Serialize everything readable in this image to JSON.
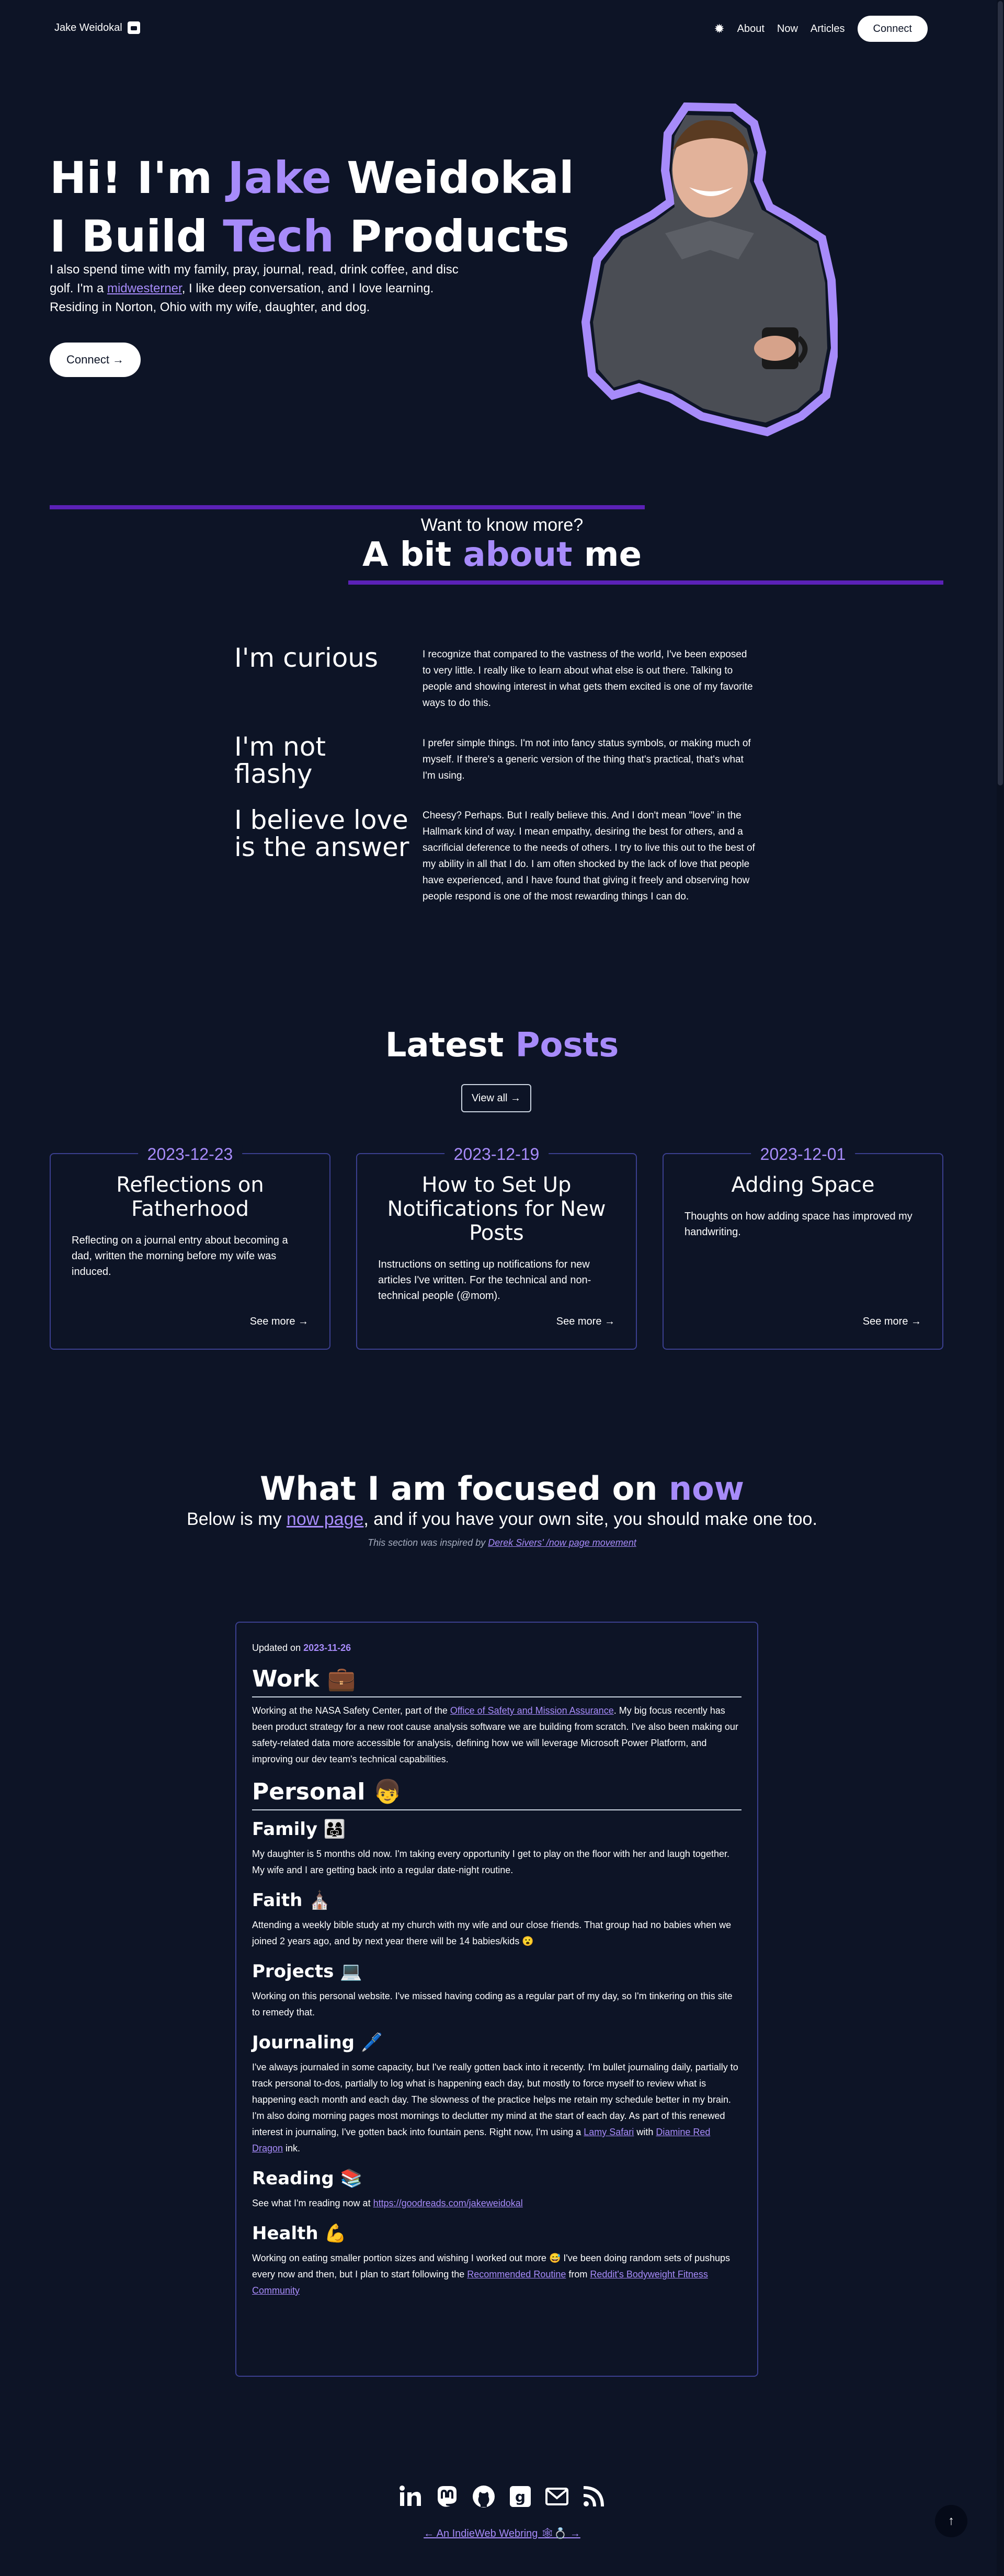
{
  "nav": {
    "brand": "Jake Weidokal",
    "links": [
      "About",
      "Now",
      "Articles"
    ],
    "connect": "Connect"
  },
  "hero": {
    "line1_pre": "Hi! I'm ",
    "line1_accent": "Jake",
    "line1_post": " Weidokal",
    "line2_pre": "I Build ",
    "line2_accent": "Tech",
    "line2_post": " Products",
    "text_pre": "I also spend time with my family, pray, journal, read, drink coffee, and disc golf. I'm a ",
    "text_link": "midwesterner",
    "text_post": ", I like deep conversation, and I love learning. Residing in Norton, Ohio with my wife, daughter, and dog.",
    "button": "Connect →"
  },
  "about": {
    "kicker": "Want to know more?",
    "title_pre": "A bit ",
    "title_accent": "about",
    "title_post": " me",
    "traits": [
      {
        "title": "I'm curious",
        "text": "I recognize that compared to the vastness of the world, I've been exposed to very little. I really like to learn about what else is out there. Talking to people and showing interest in what gets them excited is one of my favorite ways to do this."
      },
      {
        "title": "I'm not flashy",
        "text": "I prefer simple things. I'm not into fancy status symbols, or making much of myself. If there's a generic version of the thing that's practical, that's what I'm using."
      },
      {
        "title": "I believe love is the answer",
        "text": "Cheesy? Perhaps. But I really believe this. And I don't mean \"love\" in the Hallmark kind of way. I mean empathy, desiring the best for others, and a sacrificial deference to the needs of others. I try to live this out to the best of my ability in all that I do. I am often shocked by the lack of love that people have experienced, and I have found that giving it freely and observing how people respond is one of the most rewarding things I can do."
      }
    ]
  },
  "posts": {
    "title_pre": "Latest ",
    "title_accent": "Posts",
    "view_all": "View all →",
    "items": [
      {
        "date": "2023-12-23",
        "title": "Reflections on Fatherhood",
        "desc": "Reflecting on a journal entry about becoming a dad, written the morning before my wife was induced.",
        "more": "See more →"
      },
      {
        "date": "2023-12-19",
        "title": "How to Set Up Notifications for New Posts",
        "desc": "Instructions on setting up notifications for new articles I've written. For the technical and non-technical people (@mom).",
        "more": "See more →"
      },
      {
        "date": "2023-12-01",
        "title": "Adding Space",
        "desc": "Thoughts on how adding space has improved my handwriting.",
        "more": "See more →"
      }
    ]
  },
  "now": {
    "title_pre": "What I am focused on ",
    "title_accent": "now",
    "sub_pre": "Below is my ",
    "sub_link": "now page",
    "sub_post": ", and if you have your own site, you should make one too.",
    "note_pre": "This section was inspired by ",
    "note_link": "Derek Sivers' /now page movement",
    "updated_label": "Updated on ",
    "updated_date": "2023-11-26",
    "work_title": "Work 💼",
    "work_pre": "Working at the NASA Safety Center, part of the ",
    "work_link": "Office of Safety and Mission Assurance",
    "work_post": ". My big focus recently has been product strategy for a new root cause analysis software we are building from scratch. I've also been making our safety-related data more accessible for analysis, defining how we will leverage Microsoft Power Platform, and improving our dev team's technical capabilities.",
    "personal_title": "Personal 👦",
    "family_title": "Family 👨‍👩‍👧",
    "family_text": "My daughter is 5 months old now. I'm taking every opportunity I get to play on the floor with her and laugh together. My wife and I are getting back into a regular date-night routine.",
    "faith_title": "Faith ⛪",
    "faith_text": "Attending a weekly bible study at my church with my wife and our close friends. That group had no babies when we joined 2 years ago, and by next year there will be 14 babies/kids 😮",
    "projects_title": "Projects 💻",
    "projects_text": "Working on this personal website. I've missed having coding as a regular part of my day, so I'm tinkering on this site to remedy that.",
    "journaling_title": "Journaling 🖊️",
    "journaling_pre": "I've always journaled in some capacity, but I've really gotten back into it recently. I'm bullet journaling daily, partially to track personal to-dos, partially to log what is happening each day, but mostly to force myself to review what is happening each month and each day. The slowness of the practice helps me retain my schedule better in my brain. I'm also doing morning pages most mornings to declutter my mind at the start of each day. As part of this renewed interest in journaling, I've gotten back into fountain pens. Right now, I'm using a ",
    "journaling_link1": "Lamy Safari",
    "journaling_mid": " with ",
    "journaling_link2": "Diamine Red Dragon",
    "journaling_post": " ink.",
    "reading_title": "Reading 📚",
    "reading_pre": "See what I'm reading now at ",
    "reading_link": "https://goodreads.com/jakeweidokal",
    "health_title": "Health 💪",
    "health_pre": "Working on eating smaller portion sizes and wishing I worked out more 😅 I've been doing random sets of pushups every now and then, but I plan to start following the ",
    "health_link1": "Recommended Routine",
    "health_mid": " from ",
    "health_link2": "Reddit's Bodyweight Fitness Community"
  },
  "footer": {
    "socials": [
      "linkedin-icon",
      "mastodon-icon",
      "github-icon",
      "goodreads-icon",
      "email-icon",
      "rss-icon"
    ],
    "webring": "← An IndieWeb Webring 🕸💍 →",
    "to_top": "↑"
  }
}
